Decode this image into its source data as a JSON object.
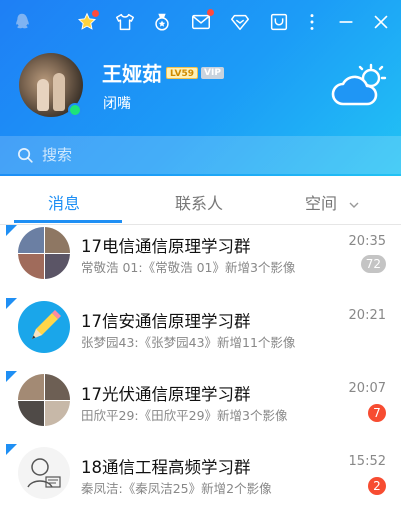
{
  "profile": {
    "nickname": "王娅茹",
    "level_badge": "LV59",
    "vip_badge": "VIP",
    "signature": "闭嘴",
    "status": "online"
  },
  "topbar": {
    "icons": [
      "qq-logo-icon",
      "star-icon",
      "tshirt-icon",
      "medal-icon",
      "mail-icon",
      "gift-box-icon",
      "folder-icon",
      "more-icon",
      "minimize-icon",
      "close-icon"
    ]
  },
  "search": {
    "placeholder": "搜索"
  },
  "tabs": [
    {
      "label": "消息",
      "active": true
    },
    {
      "label": "联系人",
      "active": false
    },
    {
      "label": "空间",
      "active": false
    }
  ],
  "messages": [
    {
      "title": "17电信通信原理学习群",
      "preview": "常敬浩 01:《常敬浩 01》新增3个影像",
      "time": "20:35",
      "count": "72",
      "count_style": "gray"
    },
    {
      "title": "17信安通信原理学习群",
      "preview": "张梦园43:《张梦园43》新增11个影像",
      "time": "20:21",
      "count": "",
      "count_style": ""
    },
    {
      "title": "17光伏通信原理学习群",
      "preview": "田欣平29:《田欣平29》新增3个影像",
      "time": "20:07",
      "count": "7",
      "count_style": "red"
    },
    {
      "title": "18通信工程高频学习群",
      "preview": "秦凤洁:《秦凤洁25》新增2个影像",
      "time": "15:52",
      "count": "2",
      "count_style": "red"
    }
  ],
  "colors": {
    "accent": "#1f8ff4",
    "badge_red": "#f74c31",
    "online": "#1ee37a"
  }
}
